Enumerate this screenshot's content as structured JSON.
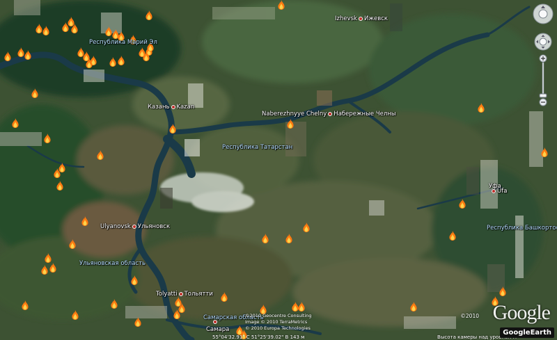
{
  "cities": {
    "izhevsk": {
      "en": "Izhevsk",
      "ru": "Ижевск"
    },
    "kazan": {
      "ru": "Казань",
      "en": "Kazan"
    },
    "chelny": {
      "en": "Naberezhnyye Chelny",
      "ru": "Набережные Челны"
    },
    "ufa": {
      "ru": "Уфа",
      "en": "Ufa"
    },
    "ulyanovsk": {
      "en": "Ulyanovsk",
      "ru": "Ульяновск"
    },
    "tolyatti": {
      "en": "Tolyatti",
      "ru": "Тольятти"
    },
    "samara": {
      "ru": "Самара"
    }
  },
  "regions": {
    "mari_el": "Республика Марий Эл",
    "tatarstan": "Республика Татарстан",
    "bashkortostan": "Республика Башкортоста",
    "ulyanovsk_obl": "Ульяновская область",
    "samara_obl": "Самарская область"
  },
  "credits": {
    "year": "©2010",
    "line1": "©2010 Geocentre Consulting",
    "line2": "Image © 2010 TerraMetrics",
    "line3": "© 2010 Europa Technologies"
  },
  "status": {
    "coords": "55°04'32.91\" С   51°25'39.02\" В   143 м",
    "altitude": "Высота камеры над уровнем м"
  },
  "branding": {
    "google": "Google",
    "google_earth": "GoogleEarth"
  },
  "fires": {
    "count_visible": 62
  },
  "colors": {
    "fire": "#ff7a10",
    "region_label": "#b8e0ff",
    "water": "#1a3a48"
  }
}
